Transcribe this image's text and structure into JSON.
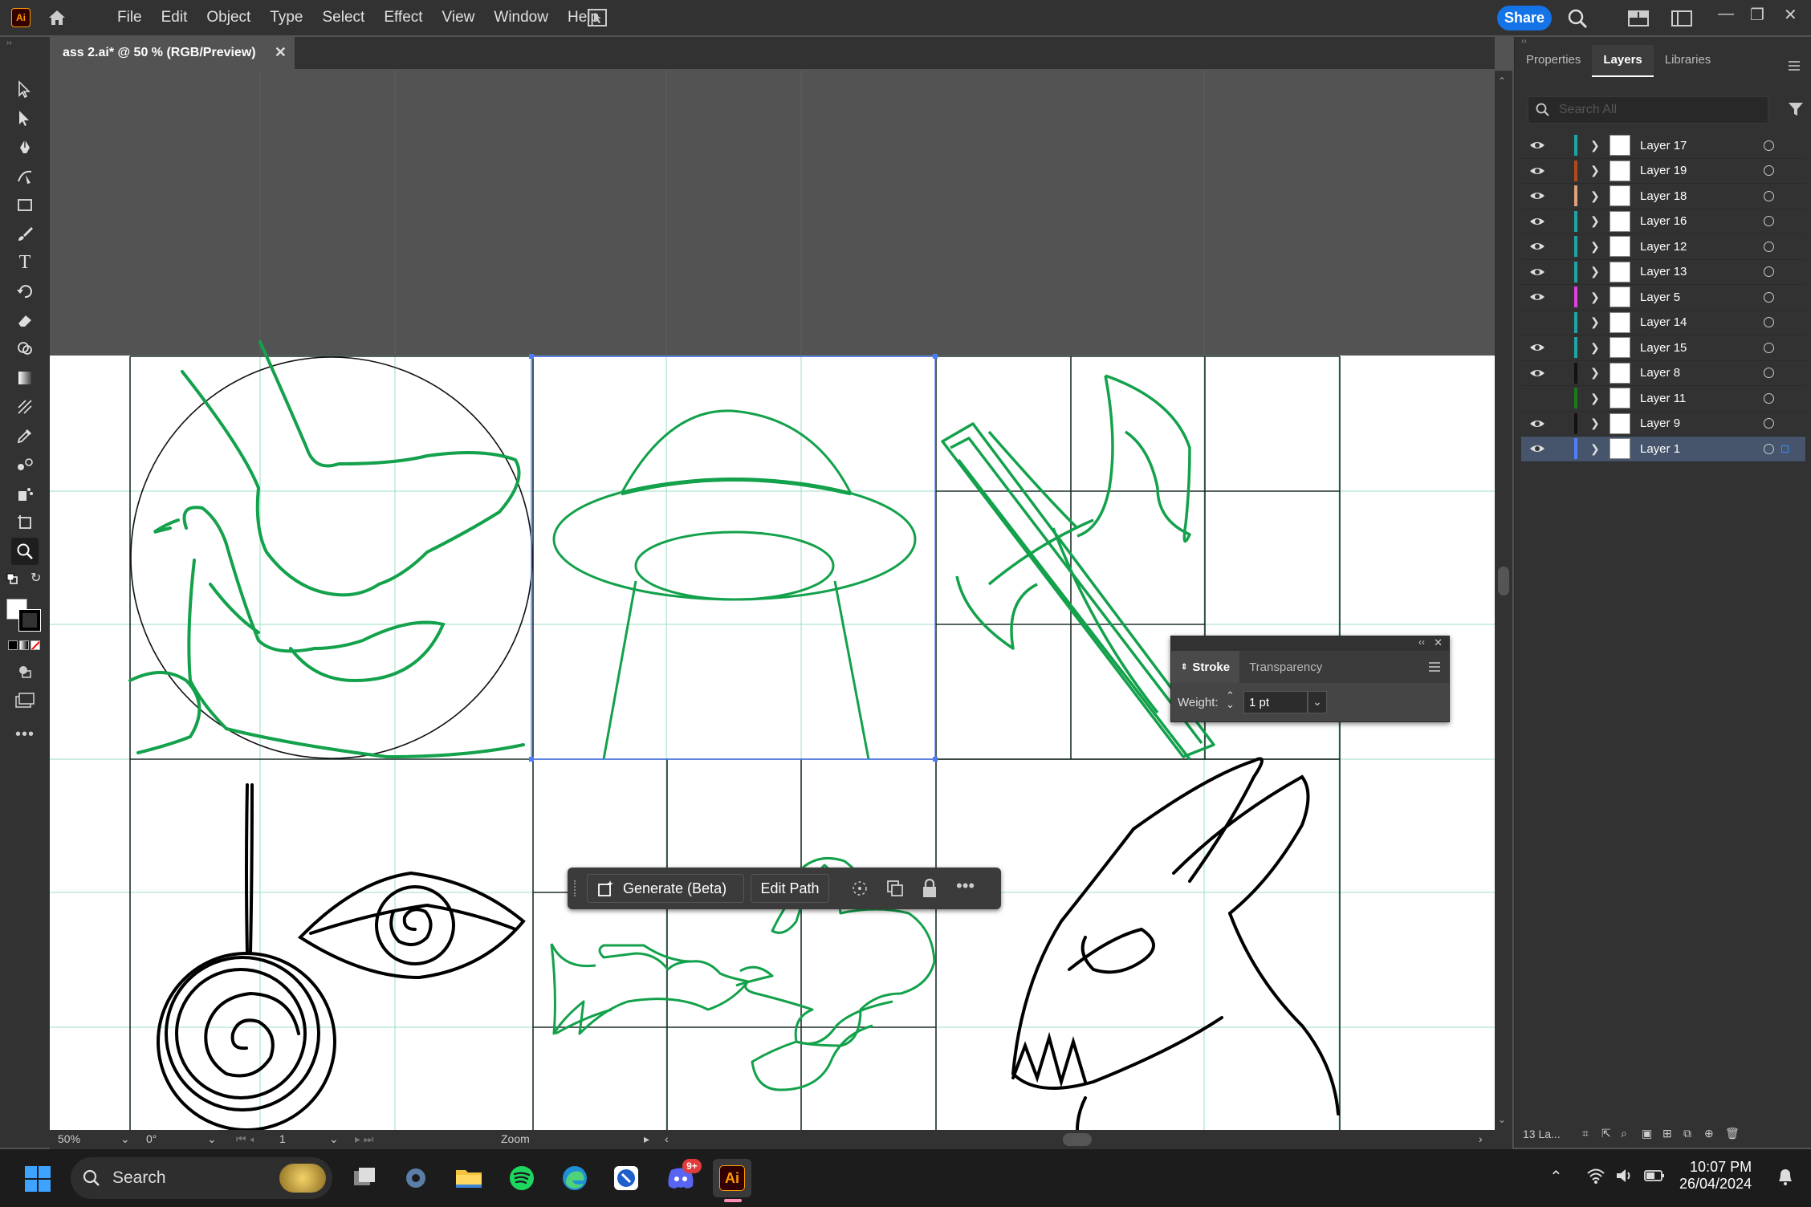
{
  "app": {
    "logo": "Ai",
    "menus": [
      "File",
      "Edit",
      "Object",
      "Type",
      "Select",
      "Effect",
      "View",
      "Window",
      "Help"
    ],
    "share_label": "Share"
  },
  "document": {
    "tab_title": "ass 2.ai* @ 50 % (RGB/Preview)"
  },
  "right_panel": {
    "tabs": [
      "Properties",
      "Layers",
      "Libraries"
    ],
    "active_tab": "Layers",
    "search_placeholder": "Search All",
    "layers": [
      {
        "name": "Layer 17",
        "color": "#1fa5a6",
        "visible": true
      },
      {
        "name": "Layer 19",
        "color": "#b4491e",
        "visible": true
      },
      {
        "name": "Layer 18",
        "color": "#e0a27a",
        "visible": true
      },
      {
        "name": "Layer 16",
        "color": "#1fa5a6",
        "visible": true
      },
      {
        "name": "Layer 12",
        "color": "#1fa5a6",
        "visible": true
      },
      {
        "name": "Layer 13",
        "color": "#1fa5a6",
        "visible": true
      },
      {
        "name": "Layer 5",
        "color": "#e040e0",
        "visible": true
      },
      {
        "name": "Layer 14",
        "color": "#1fa5a6",
        "visible": false
      },
      {
        "name": "Layer 15",
        "color": "#1fa5a6",
        "visible": true
      },
      {
        "name": "Layer 8",
        "color": "#111111",
        "visible": true
      },
      {
        "name": "Layer 11",
        "color": "#1b7a1b",
        "visible": false
      },
      {
        "name": "Layer 9",
        "color": "#111111",
        "visible": true
      },
      {
        "name": "Layer 1",
        "color": "#4f7fff",
        "visible": true,
        "selected": true
      }
    ],
    "footer_count": "13 La..."
  },
  "stroke_panel": {
    "tabs": [
      "Stroke",
      "Transparency"
    ],
    "weight_label": "Weight:",
    "weight_value": "1 pt"
  },
  "context_bar": {
    "generate_label": "Generate (Beta)",
    "edit_path_label": "Edit Path"
  },
  "status_bar": {
    "zoom": "50%",
    "rotation": "0°",
    "artboard_index": "1",
    "tool_name": "Zoom"
  },
  "taskbar": {
    "search_label": "Search",
    "discord_badge": "9+",
    "time": "10:07 PM",
    "date": "26/04/2024"
  }
}
